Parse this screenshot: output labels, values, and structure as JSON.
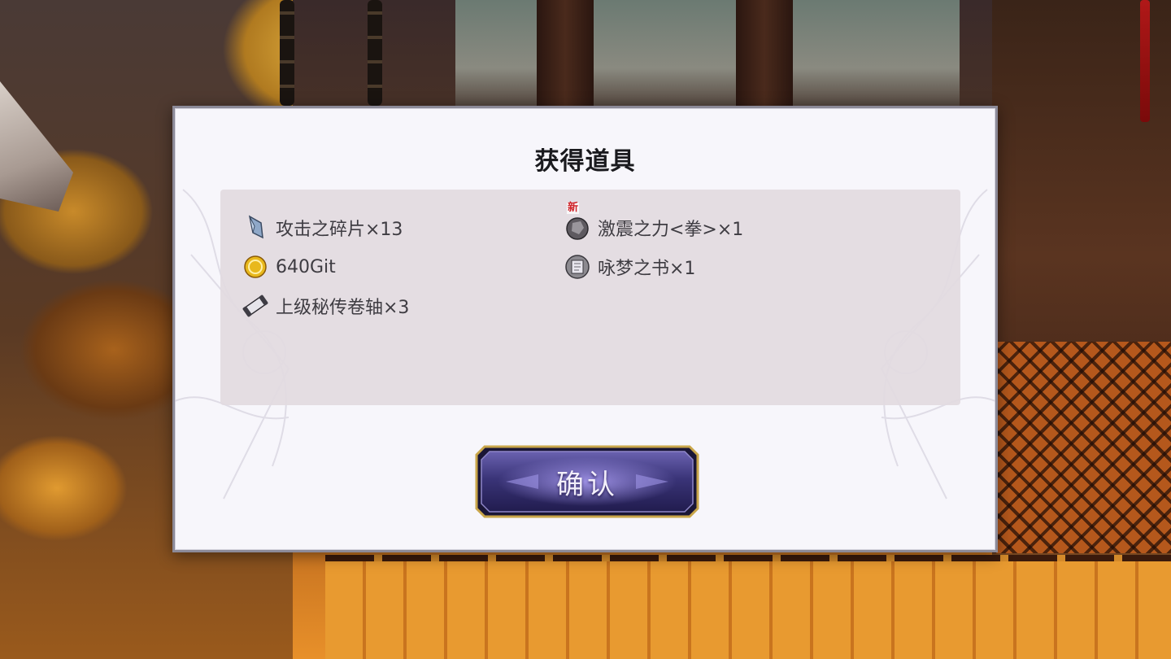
{
  "dialog": {
    "title": "获得道具",
    "items": [
      {
        "label": "攻击之碎片×13",
        "icon": "crystal-shard-icon",
        "new": false
      },
      {
        "label": "激震之力<拳>×1",
        "icon": "stone-orb-icon",
        "new": true,
        "new_label": "新"
      },
      {
        "label": "640Git",
        "icon": "gold-coin-icon",
        "new": false
      },
      {
        "label": "咏梦之书×1",
        "icon": "dream-book-icon",
        "new": false
      },
      {
        "label": "上级秘传卷轴×3",
        "icon": "scroll-icon",
        "new": false
      }
    ],
    "confirm_label": "确认"
  },
  "colors": {
    "dialog_bg": "#f7f6fb",
    "panel_bg": "#e2dae0",
    "button_fill": "#3a3478",
    "button_border": "#c9a64a",
    "new_badge": "#d0242a"
  }
}
